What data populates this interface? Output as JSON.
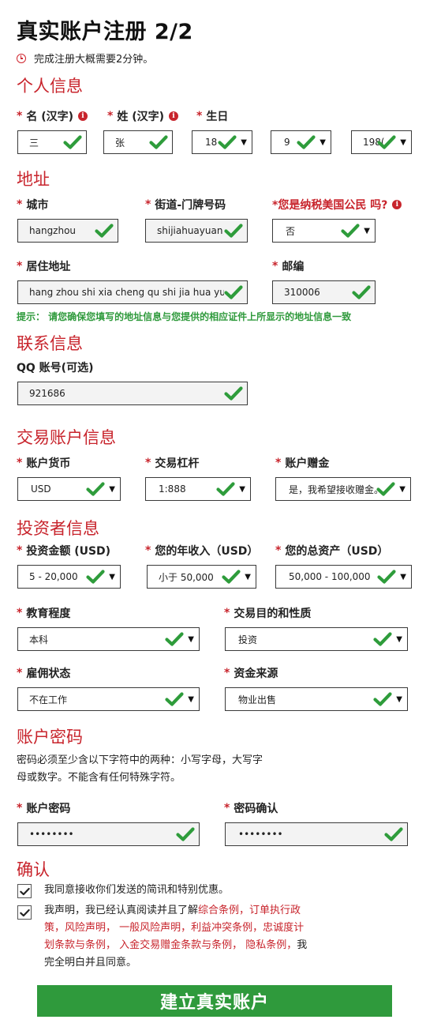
{
  "header": {
    "title": "真实账户注册 2/2",
    "notice": "完成注册大概需要2分钟。"
  },
  "personal": {
    "section": "个人信息",
    "first_name_label": "名 (汉字)",
    "last_name_label": "姓 (汉字)",
    "birthday_label": "生日",
    "first_name": "三",
    "last_name": "张",
    "birth_day": "18",
    "birth_month": "9",
    "birth_year": "198("
  },
  "address": {
    "section": "地址",
    "city_label": "城市",
    "street_label": "街道-门牌号码",
    "us_tax_label": "*您是纳税美国公民 吗?",
    "city": "hangzhou",
    "street": "shijiahuayuan",
    "us_tax": "否",
    "residence_label": "居住地址",
    "zip_label": "邮编",
    "residence": "hang zhou shi xia cheng qu shi jia hua yuan",
    "zip": "310006",
    "hint": "提示： 请您确保您填写的地址信息与您提供的相应证件上所显示的地址信息一致"
  },
  "contact": {
    "section": "联系信息",
    "qq_label": "QQ 账号(可选)",
    "qq": "921686"
  },
  "trading": {
    "section": "交易账户信息",
    "currency_label": "账户货币",
    "leverage_label": "交易杠杆",
    "bonus_label": "账户赠金",
    "currency": "USD",
    "leverage": "1:888",
    "bonus": "是，我希望接收赠金。"
  },
  "investor": {
    "section": "投资者信息",
    "amount_label": "投资金额 (USD)",
    "income_label": "您的年收入（USD）",
    "assets_label": "您的总资产（USD）",
    "amount": "5 - 20,000",
    "income": "小于 50,000",
    "assets": "50,000 - 100,000",
    "education_label": "教育程度",
    "purpose_label": "交易目的和性质",
    "education": "本科",
    "purpose": "投资",
    "employment_label": "雇佣状态",
    "funds_label": "资金来源",
    "employment": "不在工作",
    "funds": "物业出售"
  },
  "password": {
    "section": "账户密码",
    "desc_line1": "密码必须至少含以下字符中的两种：小写字母，大写字",
    "desc_line2": "母或数字。不能含有任何特殊字符。",
    "password_label": "账户密码",
    "confirm_label": "密码确认",
    "password": "••••••••",
    "confirm": "••••••••"
  },
  "confirm": {
    "section": "确认",
    "promo_text": "我同意接收你们发送的简讯和特别优惠。",
    "declare_1": "我声明，我已经认真阅读并且了解",
    "link_terms": "综合条例，订单执行政策，风险声明，  一般风险声明，利益冲突条例，忠诚度计划条款与条例，  入金交易赠金条款与条例，  隐私条例，",
    "declare_2": "我完全明白并且同意。"
  },
  "submit_label": "建立真实账户",
  "colors": {
    "accent_red": "#c8242c",
    "accent_green": "#2f9a3c",
    "check_green": "#2e9c3b"
  }
}
